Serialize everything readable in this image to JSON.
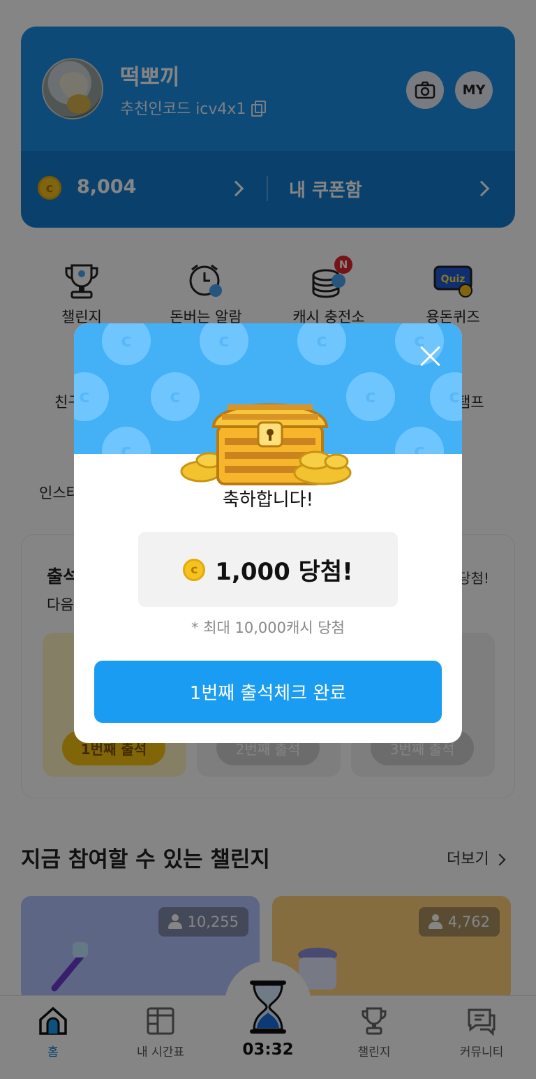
{
  "profile": {
    "nickname": "떡뽀끼",
    "referral_code": "추천인코드 icv4x1",
    "my_label": "MY",
    "coin_balance": "8,004",
    "coupon_label": "내 쿠폰함"
  },
  "menu": [
    {
      "label": "챌린지",
      "icon": "trophy-icon"
    },
    {
      "label": "돈버는 알람",
      "icon": "alarm-clock-icon"
    },
    {
      "label": "캐시 충전소",
      "icon": "coin-stack-icon",
      "badge": "N"
    },
    {
      "label": "용돈퀴즈",
      "icon": "quiz-icon"
    }
  ],
  "menu_row2": {
    "left_partial": "친구",
    "right_partial": "탬프",
    "left3_partial": "인스타"
  },
  "attendance": {
    "title": "출석",
    "subtitle": "다음",
    "right_note": "당첨!",
    "days": [
      "1번째 출석",
      "2번째 출석",
      "3번째 출석"
    ]
  },
  "challenges": {
    "section_title": "지금 참여할 수 있는 챌린지",
    "more_label": "더보기",
    "cards": [
      {
        "participants": "10,255",
        "color": "#b3c5ff"
      },
      {
        "participants": "4,762",
        "color": "#ffd27a"
      }
    ]
  },
  "bottom_nav": {
    "home": "홈",
    "timetable": "내 시간표",
    "timer": "03:32",
    "challenge": "챌린지",
    "community": "커뮤니티"
  },
  "modal": {
    "congrats": "축하합니다!",
    "prize": "1,000 당첨!",
    "max_note": "* 최대 10,000캐시 당첨",
    "confirm_label": "1번째 출석체크 완료"
  },
  "colors": {
    "accent_blue": "#1a9cf2",
    "profile_blue": "#1a8fe6",
    "coin_gold": "#f6c21c"
  }
}
